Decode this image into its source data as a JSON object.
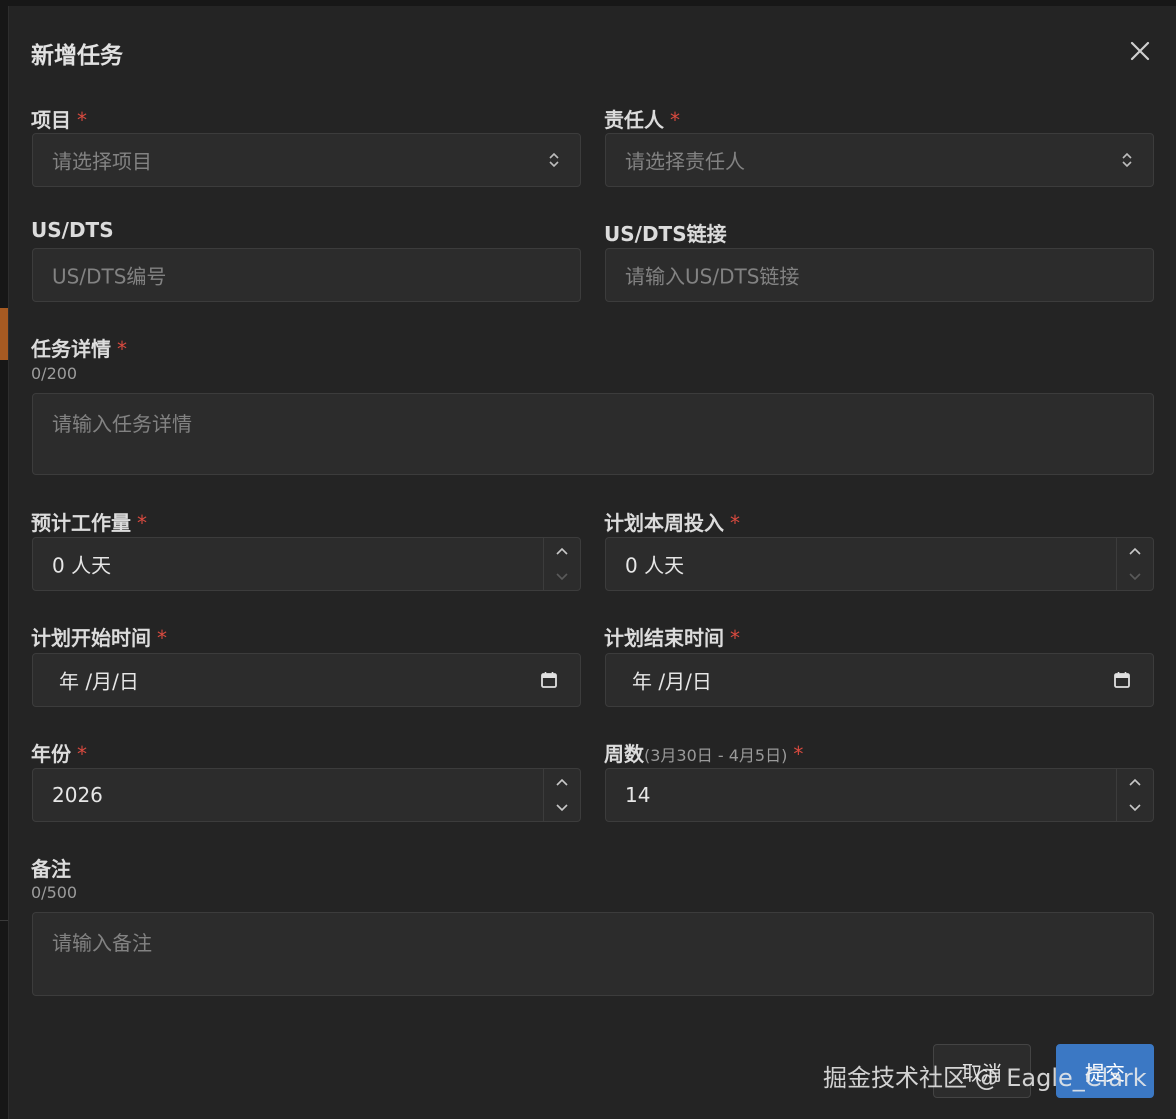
{
  "dialog": {
    "title": "新增任务",
    "close_icon": "close-icon",
    "required_mark": "*"
  },
  "fields": {
    "project": {
      "label": "项目",
      "placeholder": "请选择项目"
    },
    "owner": {
      "label": "责任人",
      "placeholder": "请选择责任人"
    },
    "us_dts": {
      "label": "US/DTS",
      "placeholder": "US/DTS编号"
    },
    "us_dts_link": {
      "label": "US/DTS链接",
      "placeholder": "请输入US/DTS链接"
    },
    "task_detail": {
      "label": "任务详情",
      "counter": "0/200",
      "placeholder": "请输入任务详情"
    },
    "estimated_effort": {
      "label": "预计工作量",
      "value": "0 人天"
    },
    "planned_this_week": {
      "label": "计划本周投入",
      "value": "0 人天"
    },
    "planned_start": {
      "label": "计划开始时间",
      "value": "年 /月/日"
    },
    "planned_end": {
      "label": "计划结束时间",
      "value": "年 /月/日"
    },
    "year": {
      "label": "年份",
      "value": "2026"
    },
    "week": {
      "label": "周数",
      "hint": "(3月30日 - 4月5日)",
      "value": "14"
    },
    "remark": {
      "label": "备注",
      "counter": "0/500",
      "placeholder": "请输入备注"
    }
  },
  "buttons": {
    "cancel": "取消",
    "submit": "提交"
  },
  "watermark": "掘金技术社区 @ Eagle_Clark",
  "colors": {
    "dialog_bg": "#242424",
    "input_bg": "#2c2c2c",
    "required": "#d84a3f",
    "primary": "#3b78c4"
  }
}
